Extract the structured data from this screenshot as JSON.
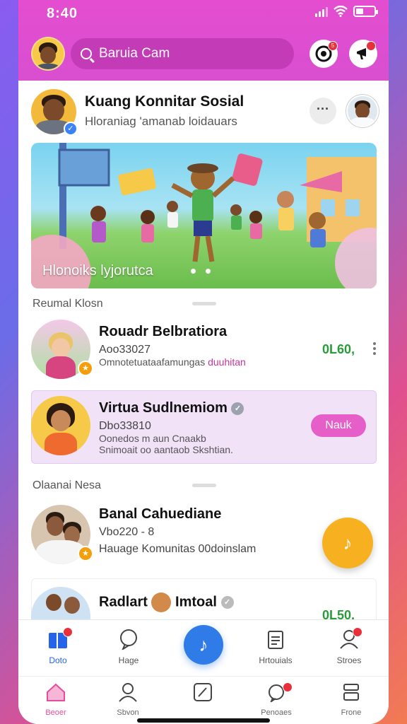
{
  "status": {
    "time": "8:40"
  },
  "search": {
    "placeholder": "Baruia Cam"
  },
  "header": {
    "notif_badge": "5"
  },
  "profile": {
    "title": "Kuang Konnitar Sosial",
    "subtitle": "Hloraniag 'amanab loidauars"
  },
  "hero": {
    "caption": "Hlonoiks lyjorutca"
  },
  "sections": {
    "first": "Reumal Klosn",
    "second": "Olaanai Nesa"
  },
  "rows": [
    {
      "title": "Rouadr Belbratiora",
      "line1": "Aoo33027",
      "line2": "Omnotetuataafamungas",
      "line2_accent": "duuhitan",
      "amount": "0L60,"
    },
    {
      "title": "Virtua Sudlnemiom",
      "line1": "Dbo33810",
      "line2": "Oonedos m aun Cnaakb",
      "line3": "Snimoait oo aantaob Skshtian.",
      "action": "Nauk"
    },
    {
      "title": "Banal Cahuediane",
      "line1": "Vbo220 - 8",
      "line2": "Hauage Komunitas 00doinslam"
    },
    {
      "title": "Radlart",
      "title2": "Imtoal",
      "amount": "0L50,"
    }
  ],
  "tabs": [
    {
      "label": "Doto",
      "icon": "flag-icon",
      "badge": ""
    },
    {
      "label": "Hage",
      "icon": "chat-bubble-icon"
    },
    {
      "label": "",
      "icon": "music-note-icon"
    },
    {
      "label": "Hrtouials",
      "icon": "clipboard-icon"
    },
    {
      "label": "Stroes",
      "icon": "user-icon"
    }
  ],
  "bottom_tabs": [
    {
      "label": "Beoer",
      "icon": "home-icon"
    },
    {
      "label": "Sbvon",
      "icon": "person-icon"
    },
    {
      "label": "",
      "icon": "edit-icon"
    },
    {
      "label": "Penoaes",
      "icon": "bell-icon"
    },
    {
      "label": "Frone",
      "icon": "layers-icon"
    }
  ],
  "colors": {
    "brand": "#e44dcf",
    "accent": "#2f7be8",
    "amount": "#2a9b3a",
    "fab": "#f7b120"
  }
}
